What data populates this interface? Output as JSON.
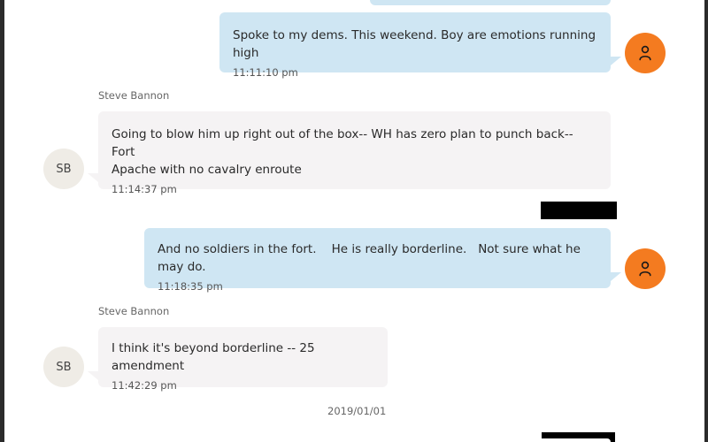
{
  "messages": [
    {
      "direction": "outgoing",
      "text": "Spoke to my dems. This weekend. Boy are emotions running high",
      "time": "11:11:10 pm"
    },
    {
      "direction": "incoming",
      "sender": "Steve Bannon",
      "initials": "SB",
      "text": "Going to blow him up right out of the box-- WH has zero plan to punch back-- Fort\nApache with no cavalry enroute",
      "time": "11:14:37 pm"
    },
    {
      "direction": "outgoing",
      "text": "And no soldiers in the fort.    He is really borderline.   Not sure what he may do.",
      "time": "11:18:35 pm"
    },
    {
      "direction": "incoming",
      "sender": "Steve Bannon",
      "initials": "SB",
      "text": "I think it's beyond borderline -- 25 amendment",
      "time": "11:42:29 pm"
    }
  ],
  "date_separator": "2019/01/01",
  "icons": {
    "self_avatar": "person-icon"
  },
  "colors": {
    "outgoing_bubble": "#cfe6f3",
    "incoming_bubble": "#f5f3f4",
    "self_avatar": "#f47b20",
    "contact_avatar": "#efece6",
    "redaction": "#000000"
  }
}
